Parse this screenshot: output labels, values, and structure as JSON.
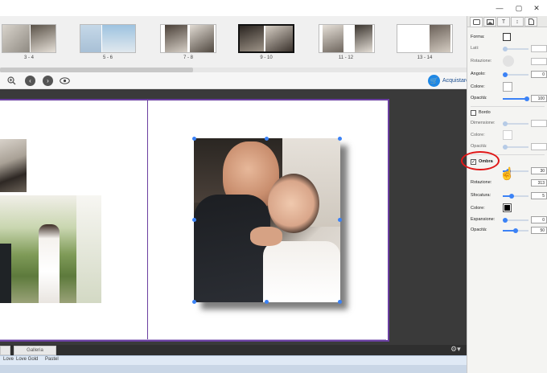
{
  "window": {
    "controls": [
      "—",
      "▢",
      "✕"
    ]
  },
  "filmstrip": {
    "thumbnails": [
      {
        "label": "3 - 4"
      },
      {
        "label": "5 - 6"
      },
      {
        "label": "7 - 8"
      },
      {
        "label": "9 - 10",
        "selected": true
      },
      {
        "label": "11 - 12"
      },
      {
        "label": "13 - 14"
      }
    ]
  },
  "toolbar": {
    "buy_label": "Acquistare"
  },
  "bottom_tabs": {
    "gallery_label": "Galleria"
  },
  "palette": {
    "items": [
      "Love",
      "Love Gold",
      "Pastel"
    ]
  },
  "panel": {
    "tabs": [
      "layout-tab",
      "image-tab",
      "text-tab",
      "spacing-tab",
      "page-tab"
    ],
    "forma_label": "Forma:",
    "lati_label": "Lati:",
    "rotazione_label": "Rotazione:",
    "angolo_label": "Angolo:",
    "angolo_value": "0",
    "colore_label": "Colore:",
    "opacita_label": "Opacità:",
    "opacita_value": "100",
    "bordo_label": "Bordo",
    "dimensione_label": "Dimensione:",
    "bordo_colore_label": "Colore:",
    "bordo_opacita_label": "Opacità:",
    "ombra_label": "Ombra",
    "ombra_checked": true,
    "ombra_value": "30",
    "ombra_rotazione_label": "Rotazione:",
    "ombra_rotazione_value": "313",
    "sfocatura_label": "Sfocatura:",
    "sfocatura_value": "5",
    "ombra_colore_label": "Colore:",
    "ombra_colore": "#000000",
    "espansione_label": "Espansione:",
    "espansione_value": "0",
    "ombra_opacita_label": "Opacità:",
    "ombra_opacita_value": "50"
  },
  "colors": {
    "accent": "#3b82f6",
    "page_border": "#6a3fa0",
    "highlight_ring": "#e01818",
    "canvas_bg": "#3a3a3a"
  }
}
